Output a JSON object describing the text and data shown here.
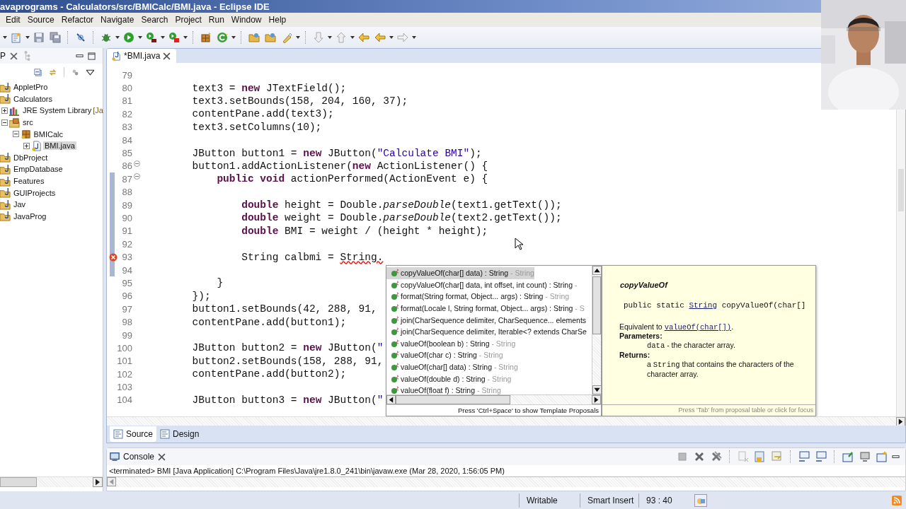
{
  "window": {
    "title": "avaprograms - Calculators/src/BMICalc/BMI.java - Eclipse IDE"
  },
  "menu": [
    "Edit",
    "Source",
    "Refactor",
    "Navigate",
    "Search",
    "Project",
    "Run",
    "Window",
    "Help"
  ],
  "explorer": {
    "tab_label": "P",
    "tree": [
      {
        "label": "AppletPro",
        "kind": "project",
        "selected": false
      },
      {
        "label": "Calculators",
        "kind": "project",
        "selected": false,
        "children": [
          {
            "label": "JRE System Library",
            "suffix": "[Ja",
            "kind": "library",
            "expanded": false,
            "selected": false
          },
          {
            "label": "src",
            "kind": "source_folder",
            "expanded": true,
            "selected": false,
            "children": [
              {
                "label": "BMICalc",
                "kind": "package",
                "expanded": true,
                "selected": false,
                "children": [
                  {
                    "label": "BMI.java",
                    "kind": "file",
                    "expanded": false,
                    "selected": true
                  }
                ]
              }
            ]
          }
        ]
      },
      {
        "label": "DbProject",
        "kind": "project",
        "selected": false
      },
      {
        "label": "EmpDatabase",
        "kind": "project",
        "selected": false
      },
      {
        "label": "Features",
        "kind": "project",
        "selected": false
      },
      {
        "label": "GUIProjects",
        "kind": "project",
        "selected": false
      },
      {
        "label": "Jav",
        "kind": "project",
        "selected": false
      },
      {
        "label": "JavaProg",
        "kind": "project",
        "selected": false
      }
    ]
  },
  "editor": {
    "tab": "*BMI.java",
    "lines": [
      {
        "number": "79",
        "changed": false,
        "fold": false,
        "error": false
      },
      {
        "number": "80",
        "segments": [
          {
            "text": "text3 = ",
            "kind": "plain"
          },
          {
            "text": "new",
            "kind": "keyword"
          },
          {
            "text": " JTextField();",
            "kind": "plain"
          }
        ],
        "changed": false,
        "fold": false,
        "error": false
      },
      {
        "number": "81",
        "segments": [
          {
            "text": "text3.setBounds(158, 204, 160, 37);",
            "kind": "plain"
          }
        ],
        "changed": false,
        "fold": false,
        "error": false
      },
      {
        "number": "82",
        "segments": [
          {
            "text": "contentPane.add(text3);",
            "kind": "plain"
          }
        ],
        "changed": false,
        "fold": false,
        "error": false
      },
      {
        "number": "83",
        "segments": [
          {
            "text": "text3.setColumns(10);",
            "kind": "plain"
          }
        ],
        "changed": false,
        "fold": false,
        "error": false
      },
      {
        "number": "84",
        "changed": false,
        "fold": false,
        "error": false
      },
      {
        "number": "85",
        "segments": [
          {
            "text": "JButton button1 = ",
            "kind": "plain"
          },
          {
            "text": "new",
            "kind": "keyword"
          },
          {
            "text": " JButton(",
            "kind": "plain"
          },
          {
            "text": "\"Calculate BMI\"",
            "kind": "string"
          },
          {
            "text": ");",
            "kind": "plain"
          }
        ],
        "changed": false,
        "fold": false,
        "error": false
      },
      {
        "number": "86",
        "segments": [
          {
            "text": "button1.addActionListener(",
            "kind": "plain"
          },
          {
            "text": "new",
            "kind": "keyword"
          },
          {
            "text": " ActionListener() {",
            "kind": "plain"
          }
        ],
        "changed": false,
        "fold": true,
        "error": false
      },
      {
        "number": "87",
        "segments": [
          {
            "text": "public",
            "kind": "keyword"
          },
          {
            "text": " void",
            "kind": "keyword"
          },
          {
            "text": " actionPerformed(ActionEvent e) {",
            "kind": "plain"
          }
        ],
        "changed": true,
        "fold": true,
        "error": false
      },
      {
        "number": "88",
        "changed": true,
        "fold": false,
        "error": false
      },
      {
        "number": "89",
        "segments": [
          {
            "text": "double",
            "kind": "keyword"
          },
          {
            "text": " height = Double.",
            "kind": "plain"
          },
          {
            "text": "parseDouble",
            "kind": "italic"
          },
          {
            "text": "(text1.getText());",
            "kind": "plain"
          }
        ],
        "changed": true,
        "fold": false,
        "error": false
      },
      {
        "number": "90",
        "segments": [
          {
            "text": "double",
            "kind": "keyword"
          },
          {
            "text": " weight = Double.",
            "kind": "plain"
          },
          {
            "text": "parseDouble",
            "kind": "italic"
          },
          {
            "text": "(text2.getText());",
            "kind": "plain"
          }
        ],
        "changed": true,
        "fold": false,
        "error": false
      },
      {
        "number": "91",
        "segments": [
          {
            "text": "double",
            "kind": "keyword"
          },
          {
            "text": " BMI = weight / (height * height);",
            "kind": "plain"
          }
        ],
        "changed": true,
        "fold": false,
        "error": false
      },
      {
        "number": "92",
        "changed": true,
        "fold": false,
        "error": false
      },
      {
        "number": "93",
        "segments": [
          {
            "text": "String calbmi = ",
            "kind": "plain"
          },
          {
            "text": "String.",
            "kind": "error"
          }
        ],
        "changed": true,
        "fold": false,
        "error": true
      },
      {
        "number": "94",
        "changed": true,
        "fold": false,
        "error": false
      },
      {
        "number": "95",
        "segments": [
          {
            "text": "}",
            "kind": "plain"
          }
        ],
        "changed": false,
        "fold": false,
        "error": false
      },
      {
        "number": "96",
        "segments": [
          {
            "text": "});",
            "kind": "plain"
          }
        ],
        "changed": false,
        "fold": false,
        "error": false
      },
      {
        "number": "97",
        "segments": [
          {
            "text": "button1.setBounds(42, 288, 91,",
            "kind": "plain"
          }
        ],
        "changed": false,
        "fold": false,
        "error": false
      },
      {
        "number": "98",
        "segments": [
          {
            "text": "contentPane.add(button1);",
            "kind": "plain"
          }
        ],
        "changed": false,
        "fold": false,
        "error": false
      },
      {
        "number": "99",
        "changed": false,
        "fold": false,
        "error": false
      },
      {
        "number": "100",
        "segments": [
          {
            "text": "JButton button2 = ",
            "kind": "plain"
          },
          {
            "text": "new",
            "kind": "keyword"
          },
          {
            "text": " JButton(",
            "kind": "plain"
          },
          {
            "text": "\"",
            "kind": "string"
          }
        ],
        "changed": false,
        "fold": false,
        "error": false
      },
      {
        "number": "101",
        "segments": [
          {
            "text": "button2.setBounds(158, 288, 91,",
            "kind": "plain"
          }
        ],
        "changed": false,
        "fold": false,
        "error": false
      },
      {
        "number": "102",
        "segments": [
          {
            "text": "contentPane.add(button2);",
            "kind": "plain"
          }
        ],
        "changed": false,
        "fold": false,
        "error": false
      },
      {
        "number": "103",
        "changed": false,
        "fold": false,
        "error": false
      },
      {
        "number": "104",
        "segments": [
          {
            "text": "JButton button3 = ",
            "kind": "plain"
          },
          {
            "text": "new",
            "kind": "keyword"
          },
          {
            "text": " JButton(",
            "kind": "plain"
          },
          {
            "text": "\"",
            "kind": "string"
          }
        ],
        "changed": false,
        "fold": false,
        "error": false
      }
    ],
    "proposals": [
      {
        "label": "copyValueOf(char[] data) : String",
        "qualifier": "- String",
        "selected": true
      },
      {
        "label": "copyValueOf(char[] data, int offset, int count) : String",
        "qualifier": "-",
        "selected": false
      },
      {
        "label": "format(String format, Object... args) : String",
        "qualifier": "- String",
        "selected": false
      },
      {
        "label": "format(Locale l, String format, Object... args) : String",
        "qualifier": "- S",
        "selected": false
      },
      {
        "label": "join(CharSequence delimiter, CharSequence... elements",
        "selected": false
      },
      {
        "label": "join(CharSequence delimiter, Iterable<? extends CharSe",
        "selected": false
      },
      {
        "label": "valueOf(boolean b) : String",
        "qualifier": "- String",
        "selected": false
      },
      {
        "label": "valueOf(char c) : String",
        "qualifier": "- String",
        "selected": false
      },
      {
        "label": "valueOf(char[] data) : String",
        "qualifier": "- String",
        "selected": false
      },
      {
        "label": "valueOf(double d) : String",
        "qualifier": "- String",
        "selected": false
      },
      {
        "label": "valueOf(float f) : String",
        "qualifier": "- String",
        "selected": false
      }
    ],
    "proposals_hint": "Press 'Ctrl+Space' to show Template Proposals",
    "doc": {
      "title": "copyValueOf",
      "signature": {
        "prefix": "public static ",
        "type_link": "String",
        "suffix": " copyValueOf(char[]"
      },
      "summary": {
        "prefix": "Equivalent to ",
        "link": "valueOf(char[])",
        "suffix": "."
      },
      "sections": [
        {
          "heading": "Parameters:",
          "code": "data",
          "text": " - the character array."
        },
        {
          "heading": "Returns:",
          "lead": "a ",
          "code": "String",
          "text": " that contains the characters of the character array."
        }
      ],
      "hint": "Press 'Tab' from proposal table or click for focus"
    },
    "bottom_tabs": [
      {
        "label": "Source",
        "selected": true
      },
      {
        "label": "Design",
        "selected": false
      }
    ]
  },
  "console": {
    "tab": "Console",
    "text": "<terminated> BMI [Java Application] C:\\Program Files\\Java\\jre1.8.0_241\\bin\\javaw.exe (Mar 28, 2020, 1:56:05 PM)"
  },
  "status_bar": {
    "mode": "Writable",
    "insert": "Smart Insert",
    "position": "93 : 40"
  }
}
